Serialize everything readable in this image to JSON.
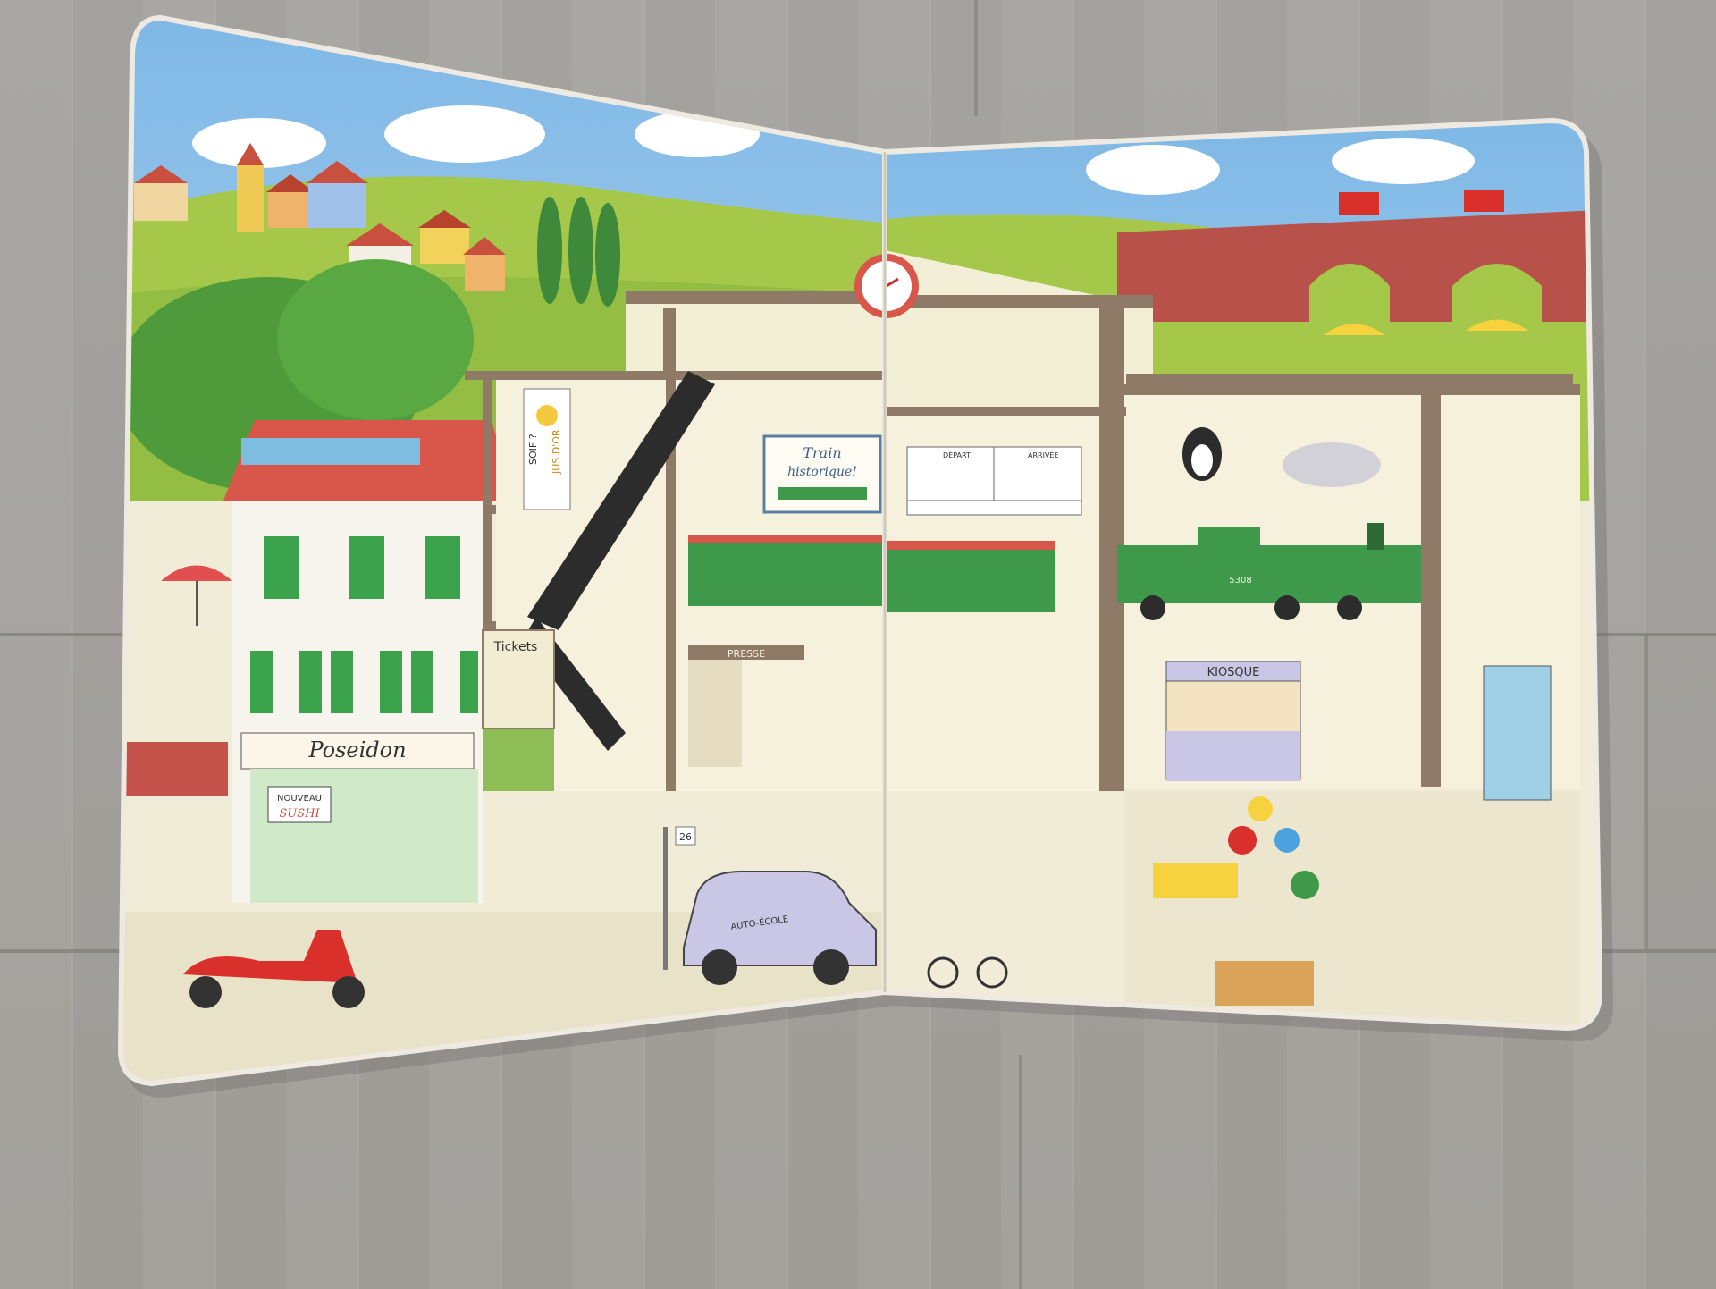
{
  "scene": {
    "hotel_sign": "Poseidon",
    "sushi_board_line1": "NOUVEAU",
    "sushi_board_line2": "SUSHI",
    "tickets_sign": "Tickets",
    "presse_sign": "PRESSE",
    "kiosque_sign": "KIOSQUE",
    "train_poster_line1": "Train",
    "train_poster_line2": "historique!",
    "departures_header": "DÉPART",
    "arrivals_header": "ARRIVÉE",
    "banner_line1": "SOIF ?",
    "banner_line2": "JUS D'OR",
    "sign_post_number": "26",
    "car_door_text": "AUTO-ÉCOLE",
    "locomotive_number": "5308"
  },
  "colors": {
    "sky": "#a9d3ef",
    "hill": "#a6c84a",
    "station_floor": "#f1ecd7",
    "beam": "#8e7a67",
    "train": "#3e9a4a",
    "roof": "#d9564a",
    "shutter": "#3aa34b"
  }
}
